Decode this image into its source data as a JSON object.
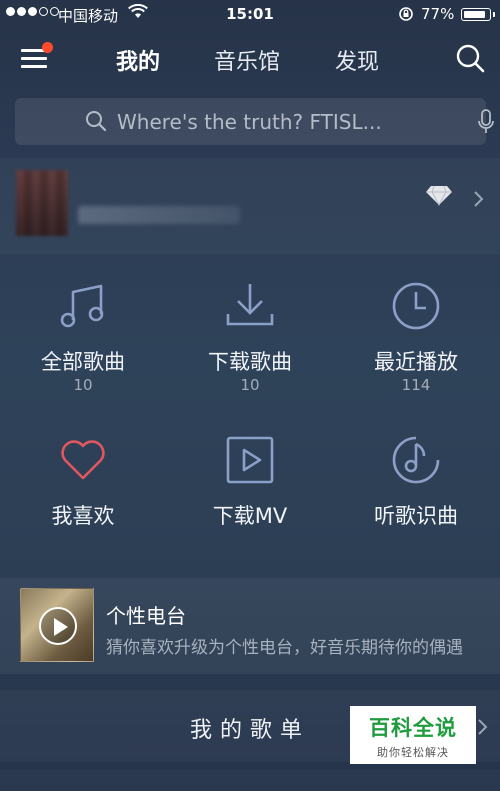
{
  "status_bar": {
    "carrier": "中国移动",
    "time": "15:01",
    "battery": "77%"
  },
  "nav": {
    "tabs": [
      {
        "label": "我的",
        "active": true
      },
      {
        "label": "音乐馆",
        "active": false
      },
      {
        "label": "发现",
        "active": false
      }
    ],
    "menu_icon": "hamburger-menu-icon",
    "search_icon": "search-icon",
    "notification_color": "#ff4b2b"
  },
  "search": {
    "placeholder": "Where's the truth? FTISL..."
  },
  "profile": {
    "badge_icon": "diamond-icon"
  },
  "shortcuts": [
    {
      "label": "全部歌曲",
      "count": "10",
      "icon": "music-note-icon"
    },
    {
      "label": "下载歌曲",
      "count": "10",
      "icon": "download-icon"
    },
    {
      "label": "最近播放",
      "count": "114",
      "icon": "clock-icon"
    },
    {
      "label": "我喜欢",
      "icon": "heart-icon",
      "icon_color": "#e0575f"
    },
    {
      "label": "下载MV",
      "icon": "video-play-icon"
    },
    {
      "label": "听歌识曲",
      "icon": "music-recognize-icon"
    }
  ],
  "radio": {
    "title": "个性电台",
    "description": "猜你喜欢升级为个性电台，好音乐期待你的偶遇"
  },
  "playlist": {
    "title": "我的歌单"
  },
  "watermark": {
    "brand": "百科全说",
    "slogan": "助你轻松解决",
    "brand_color": "#1f9c3e"
  },
  "colors": {
    "icon_blue": "#8c9fc8",
    "background": "#2b3a52"
  }
}
